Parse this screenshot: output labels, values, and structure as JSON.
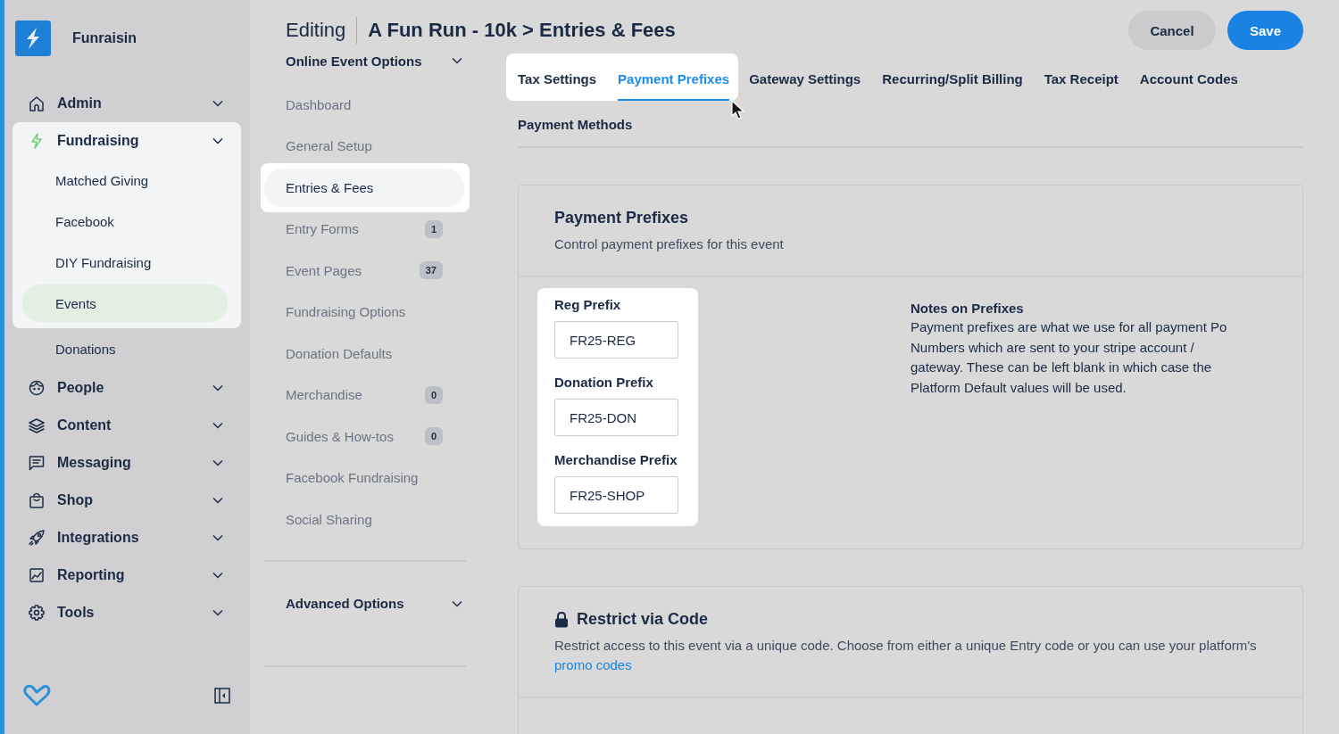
{
  "brand": {
    "name": "Funraisin"
  },
  "sidebar": {
    "items": [
      {
        "label": "Admin",
        "spotlight": false
      },
      {
        "label": "Fundraising",
        "spotlight": true,
        "children": [
          {
            "label": "Matched Giving",
            "selected": false,
            "spotlight": true
          },
          {
            "label": "Facebook",
            "selected": false,
            "spotlight": true
          },
          {
            "label": "DIY Fundraising",
            "selected": false,
            "spotlight": true
          },
          {
            "label": "Events",
            "selected": true,
            "spotlight": true
          },
          {
            "label": "Donations",
            "selected": false,
            "spotlight": false
          }
        ]
      },
      {
        "label": "People",
        "spotlight": false
      },
      {
        "label": "Content",
        "spotlight": false
      },
      {
        "label": "Messaging",
        "spotlight": false
      },
      {
        "label": "Shop",
        "spotlight": false
      },
      {
        "label": "Integrations",
        "spotlight": false
      },
      {
        "label": "Reporting",
        "spotlight": false
      },
      {
        "label": "Tools",
        "spotlight": false
      }
    ]
  },
  "header": {
    "prefix": "Editing",
    "title": "A Fun Run - 10k > Entries & Fees",
    "buttons": [
      {
        "label": "Cancel",
        "kind": "secondary"
      },
      {
        "label": "Save",
        "kind": "primary"
      }
    ]
  },
  "subnav": {
    "sections": [
      {
        "title": "Online Event Options",
        "items": [
          {
            "label": "Dashboard",
            "selected": false,
            "spotlight": false
          },
          {
            "label": "General Setup",
            "selected": false,
            "spotlight": false
          },
          {
            "label": "Entries & Fees",
            "selected": true,
            "spotlight": true
          },
          {
            "label": "Entry Forms",
            "count": "1",
            "selected": false,
            "spotlight": false
          },
          {
            "label": "Event Pages",
            "count": "37",
            "selected": false,
            "spotlight": false
          },
          {
            "label": "Fundraising Options",
            "selected": false,
            "spotlight": false
          },
          {
            "label": "Donation Defaults",
            "selected": false,
            "spotlight": false
          },
          {
            "label": "Merchandise",
            "count": "0",
            "selected": false,
            "spotlight": false
          },
          {
            "label": "Guides & How-tos",
            "count": "0",
            "selected": false,
            "spotlight": false
          },
          {
            "label": "Facebook Fundraising",
            "selected": false,
            "spotlight": false
          },
          {
            "label": "Social Sharing",
            "selected": false,
            "spotlight": false
          }
        ]
      },
      {
        "title": "Advanced Options"
      }
    ]
  },
  "tabs": [
    {
      "label": "Tax Settings",
      "selected": false,
      "spotlight": true
    },
    {
      "label": "Payment Prefixes",
      "selected": true,
      "spotlight": true
    },
    {
      "label": "Gateway Settings",
      "selected": false,
      "spotlight": false
    },
    {
      "label": "Recurring/Split Billing",
      "selected": false,
      "spotlight": false
    },
    {
      "label": "Tax Receipt",
      "selected": false,
      "spotlight": false
    },
    {
      "label": "Account Codes",
      "selected": false,
      "spotlight": false
    },
    {
      "label": "Payment Methods",
      "selected": false,
      "spotlight": false
    }
  ],
  "prefixes_card": {
    "title": "Payment Prefixes",
    "subtitle": "Control payment prefixes for this event",
    "spotlight": true,
    "fields": [
      {
        "label": "Reg Prefix",
        "value": "FR25-REG"
      },
      {
        "label": "Donation Prefix",
        "value": "FR25-DON"
      },
      {
        "label": "Merchandise Prefix",
        "value": "FR25-SHOP"
      }
    ],
    "notes_title": "Notes on Prefixes",
    "notes": "Payment prefixes are what we use for all payment Po Numbers which are sent to your stripe account / gateway. These can be left blank in which case the Platform Default values will be used."
  },
  "restrict_card": {
    "title": "Restrict via Code",
    "text": "Restrict access to this event via a unique code. Choose from either a unique Entry code or you can use your platform's",
    "link": "promo codes"
  }
}
